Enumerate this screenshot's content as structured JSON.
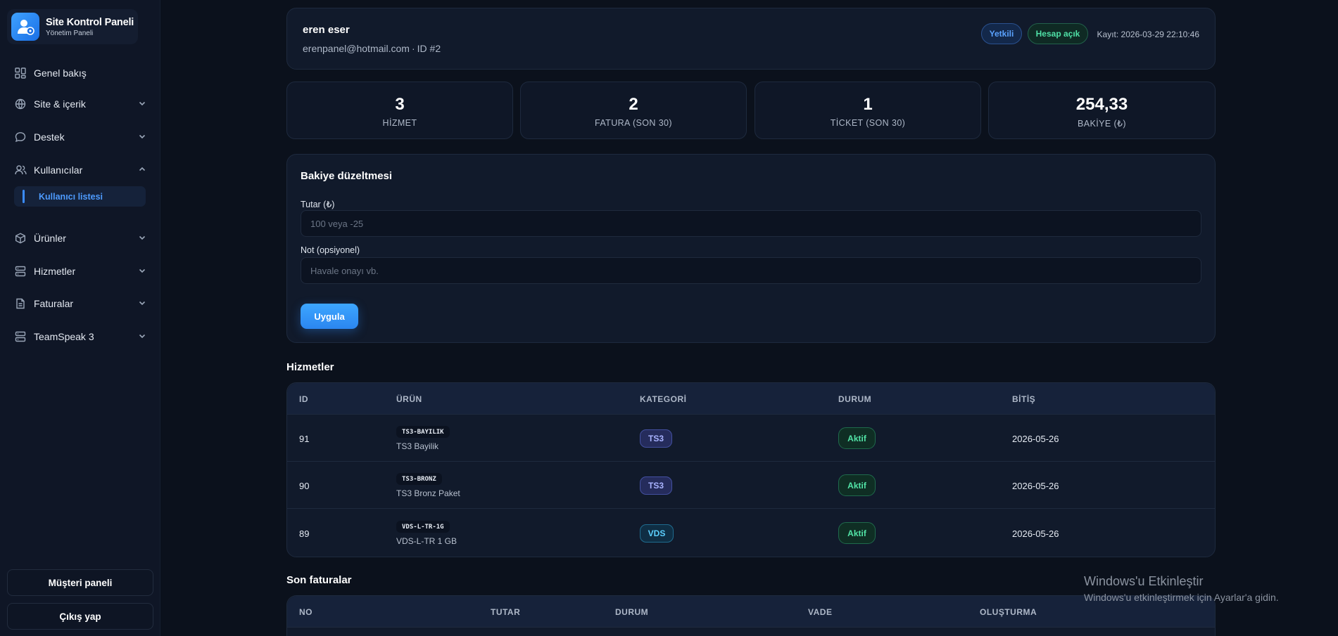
{
  "sidebar": {
    "brand_title": "Site Kontrol Paneli",
    "brand_sub": "Yönetim Paneli",
    "items": [
      {
        "label": "Genel bakış"
      },
      {
        "label": "Site & içerik"
      },
      {
        "label": "Destek"
      },
      {
        "label": "Kullanıcılar"
      },
      {
        "label": "Ürünler"
      },
      {
        "label": "Hizmetler"
      },
      {
        "label": "Faturalar"
      },
      {
        "label": "TeamSpeak 3"
      }
    ],
    "active_sub": "Kullanıcı listesi",
    "customer_panel": "Müşteri paneli",
    "logout": "Çıkış yap"
  },
  "user": {
    "name": "eren eser",
    "email": "erenpanel@hotmail.com",
    "sep": "·",
    "id": "ID #2",
    "badge_role": "Yetkili",
    "badge_status": "Hesap açık",
    "registered": "Kayıt: 2026-03-29 22:10:46"
  },
  "stats": [
    {
      "value": "3",
      "label": "HİZMET"
    },
    {
      "value": "2",
      "label": "FATURA (SON 30)"
    },
    {
      "value": "1",
      "label": "TİCKET (SON 30)"
    },
    {
      "value": "254,33",
      "label": "BAKİYE (₺)"
    }
  ],
  "balance_form": {
    "title": "Bakiye düzeltmesi",
    "amount_label": "Tutar (₺)",
    "amount_placeholder": "100 veya -25",
    "note_label": "Not (opsiyonel)",
    "note_placeholder": "Havale onayı vb.",
    "apply": "Uygula"
  },
  "services": {
    "title": "Hizmetler",
    "headers": [
      "ID",
      "ÜRÜN",
      "KATEGORİ",
      "DURUM",
      "BİTİŞ"
    ],
    "rows": [
      {
        "id": "91",
        "code": "TS3-BAYILIK",
        "name": "TS3 Bayilik",
        "category": "TS3",
        "status": "Aktif",
        "end": "2026-05-26"
      },
      {
        "id": "90",
        "code": "TS3-BRONZ",
        "name": "TS3 Bronz Paket",
        "category": "TS3",
        "status": "Aktif",
        "end": "2026-05-26"
      },
      {
        "id": "89",
        "code": "VDS-L-TR-1G",
        "name": "VDS-L-TR 1 GB",
        "category": "VDS",
        "status": "Aktif",
        "end": "2026-05-26"
      }
    ]
  },
  "invoices": {
    "title": "Son faturalar",
    "headers": [
      "NO",
      "TUTAR",
      "DURUM",
      "VADE",
      "OLUŞTURMA"
    ]
  },
  "watermark": {
    "line1": "Windows'u Etkinleştir",
    "line2": "Windows'u etkinleştirmek için Ayarlar'a gidin."
  },
  "colors": {
    "accent": "#3b8cff",
    "success": "#52e3a6",
    "background": "#0b111c"
  }
}
